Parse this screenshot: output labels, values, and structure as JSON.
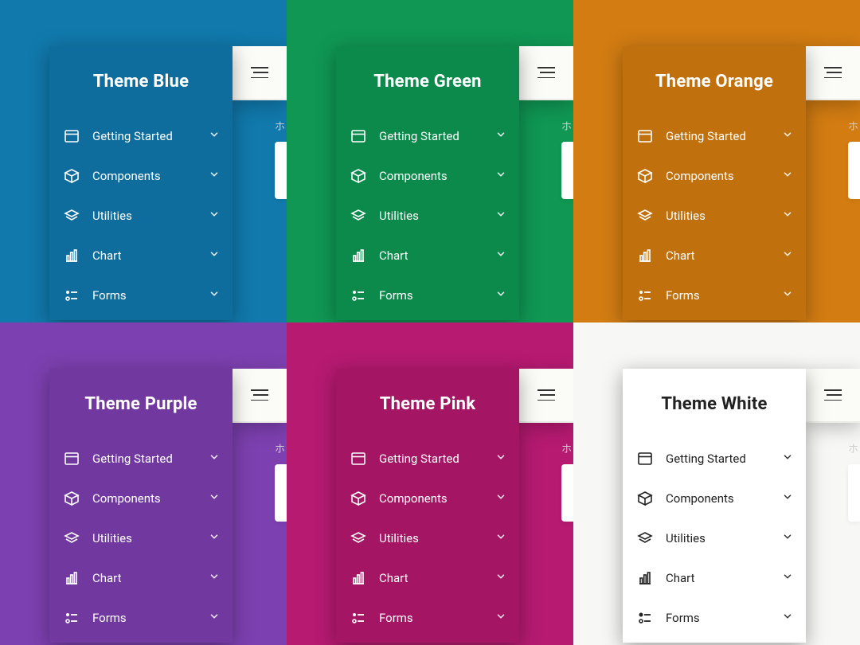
{
  "themes": [
    {
      "title": "Theme Blue",
      "bgClass": "bg-blue",
      "sbClass": "sb-blue"
    },
    {
      "title": "Theme Green",
      "bgClass": "bg-green",
      "sbClass": "sb-green"
    },
    {
      "title": "Theme Orange",
      "bgClass": "bg-orange",
      "sbClass": "sb-orange"
    },
    {
      "title": "Theme Purple",
      "bgClass": "bg-purple",
      "sbClass": "sb-purple"
    },
    {
      "title": "Theme Pink",
      "bgClass": "bg-pink",
      "sbClass": "sb-pink"
    },
    {
      "title": "Theme White",
      "bgClass": "bg-white",
      "sbClass": "sb-white"
    }
  ],
  "nav": [
    {
      "label": "Getting Started",
      "icon": "window-icon"
    },
    {
      "label": "Components",
      "icon": "cube-icon"
    },
    {
      "label": "Utilities",
      "icon": "layers-icon"
    },
    {
      "label": "Chart",
      "icon": "barchart-icon"
    },
    {
      "label": "Forms",
      "icon": "sliders-icon"
    }
  ],
  "crumb_hint": "ホ"
}
